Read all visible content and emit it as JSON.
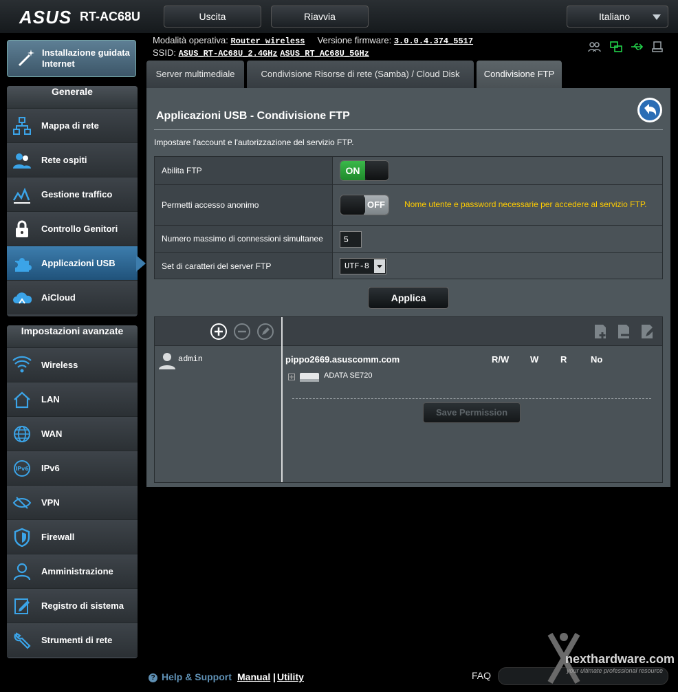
{
  "header": {
    "logo": "ASUS",
    "model": "RT-AC68U",
    "logout": "Uscita",
    "reboot": "Riavvia",
    "language": "Italiano"
  },
  "info": {
    "mode_label": "Modalità operativa:",
    "mode_value": "Router wireless",
    "fw_label": "Versione firmware:",
    "fw_value": "3.0.0.4.374_5517",
    "ssid_label": "SSID:",
    "ssid_24": "ASUS_RT-AC68U_2.4GHz",
    "ssid_5": "ASUS_RT_AC68U_5GHz"
  },
  "sidebar": {
    "quick_setup": "Installazione guidata Internet",
    "general_title": "Generale",
    "general": [
      {
        "label": "Mappa di rete",
        "icon": "network-map-icon"
      },
      {
        "label": "Rete ospiti",
        "icon": "guest-network-icon"
      },
      {
        "label": "Gestione traffico",
        "icon": "traffic-manager-icon"
      },
      {
        "label": "Controllo Genitori",
        "icon": "parental-control-icon"
      },
      {
        "label": "Applicazioni USB",
        "icon": "usb-app-icon",
        "active": true
      },
      {
        "label": "AiCloud",
        "icon": "aicloud-icon"
      }
    ],
    "advanced_title": "Impostazioni avanzate",
    "advanced": [
      {
        "label": "Wireless",
        "icon": "wireless-icon"
      },
      {
        "label": "LAN",
        "icon": "lan-icon"
      },
      {
        "label": "WAN",
        "icon": "wan-icon"
      },
      {
        "label": "IPv6",
        "icon": "ipv6-icon"
      },
      {
        "label": "VPN",
        "icon": "vpn-icon"
      },
      {
        "label": "Firewall",
        "icon": "firewall-icon"
      },
      {
        "label": "Amministrazione",
        "icon": "administration-icon"
      },
      {
        "label": "Registro di sistema",
        "icon": "system-log-icon"
      },
      {
        "label": "Strumenti di rete",
        "icon": "network-tools-icon"
      }
    ]
  },
  "tabs": [
    {
      "label": "Server multimediale"
    },
    {
      "label": "Condivisione Risorse di rete (Samba) / Cloud Disk"
    },
    {
      "label": "Condivisione FTP",
      "active": true
    }
  ],
  "main": {
    "title": "Applicazioni USB - Condivisione FTP",
    "description": "Impostare l'account e l'autorizzazione del servizio FTP.",
    "enable_ftp_label": "Abilita FTP",
    "enable_ftp_state": "ON",
    "anon_label": "Permetti accesso anonimo",
    "anon_state": "OFF",
    "anon_note": "Nome utente e password necessarie per accedere al servizio FTP.",
    "maxconn_label": "Numero massimo di connessioni simultanee",
    "maxconn_value": "5",
    "charset_label": "Set di caratteri del server FTP",
    "charset_value": "UTF-8",
    "apply": "Applica"
  },
  "accounts": {
    "users": [
      "admin"
    ],
    "host": "pippo2669.asuscomm.com",
    "perm_headers": [
      "R/W",
      "W",
      "R",
      "No"
    ],
    "disk": "ADATA SE720",
    "save": "Save Permission"
  },
  "footer": {
    "help": "Help & Support",
    "manual": "Manual",
    "sep": "|",
    "utility": "Utility",
    "faq": "FAQ"
  },
  "watermark": {
    "brand": "nexthardware.com",
    "tagline": "your ultimate professional resource"
  }
}
